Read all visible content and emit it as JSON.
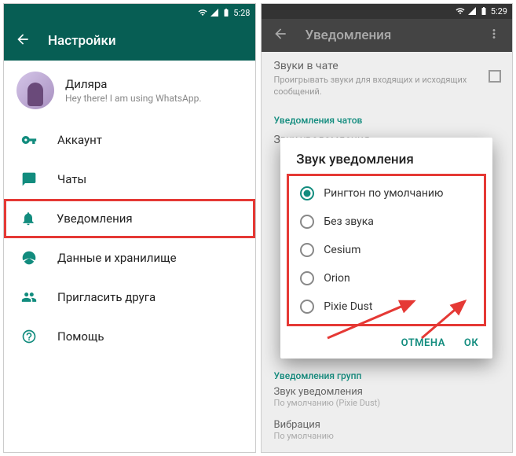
{
  "left": {
    "status_time": "5:28",
    "title": "Настройки",
    "profile": {
      "name": "Диляра",
      "status": "Hey there! I am using WhatsApp."
    },
    "menu": [
      {
        "label": "Аккаунт",
        "icon": "key"
      },
      {
        "label": "Чаты",
        "icon": "chat"
      },
      {
        "label": "Уведомления",
        "icon": "bell",
        "highlighted": true
      },
      {
        "label": "Данные и хранилище",
        "icon": "data"
      },
      {
        "label": "Пригласить друга",
        "icon": "invite"
      },
      {
        "label": "Помощь",
        "icon": "help"
      }
    ]
  },
  "right": {
    "status_time": "5:29",
    "title": "Уведомления",
    "chat_sounds": {
      "title": "Звуки в чате",
      "sub": "Проигрывать звуки для входящих и исходящих сообщений."
    },
    "section_chat": "Уведомления чатов",
    "sound_notif_dim": "Звук уведомления",
    "dialog": {
      "title": "Звук уведомления",
      "options": [
        "Рингтон по умолчанию",
        "Без звука",
        "Cesium",
        "Orion",
        "Pixie Dust"
      ],
      "selected": 0,
      "cancel": "ОТМЕНА",
      "ok": "ОК"
    },
    "section_group": "Уведомления групп",
    "group_sound": {
      "title": "Звук уведомления",
      "sub": "По умолчанию (Pixie Dust)"
    },
    "vibration": {
      "title": "Вибрация",
      "sub": "По умолчанию"
    }
  }
}
